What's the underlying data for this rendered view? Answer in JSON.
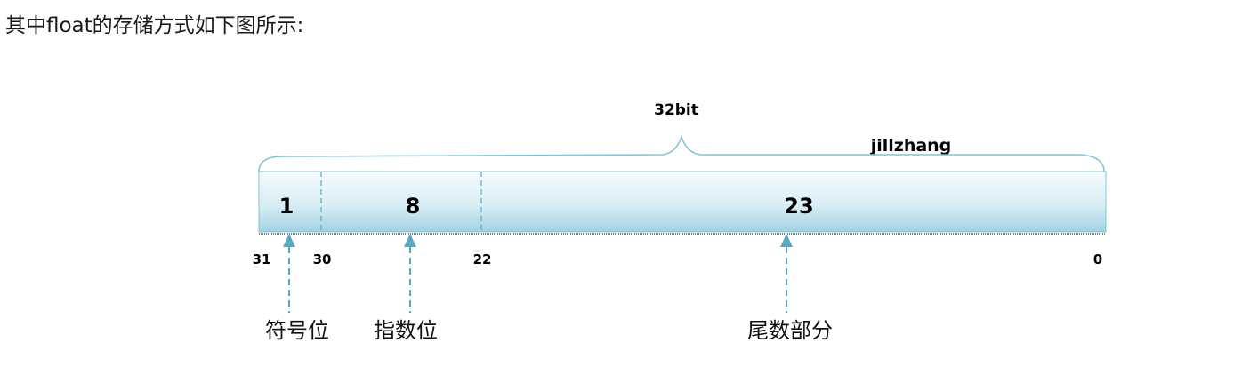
{
  "caption": "其中float的存储方式如下图所示:",
  "diagram": {
    "total_label": "32bit",
    "watermark": "jillzhang",
    "fields": [
      {
        "bits": "1"
      },
      {
        "bits": "8"
      },
      {
        "bits": "23"
      }
    ],
    "bit_indices": [
      "31",
      "30",
      "22",
      "0"
    ],
    "arrow_labels": [
      "符号位",
      "指数位",
      "尾数部分"
    ],
    "colors": {
      "bar_top": "#f4fbfd",
      "bar_bottom": "#a8d5e3",
      "border": "#7fc3d6",
      "arrow": "#55a9c4"
    }
  }
}
